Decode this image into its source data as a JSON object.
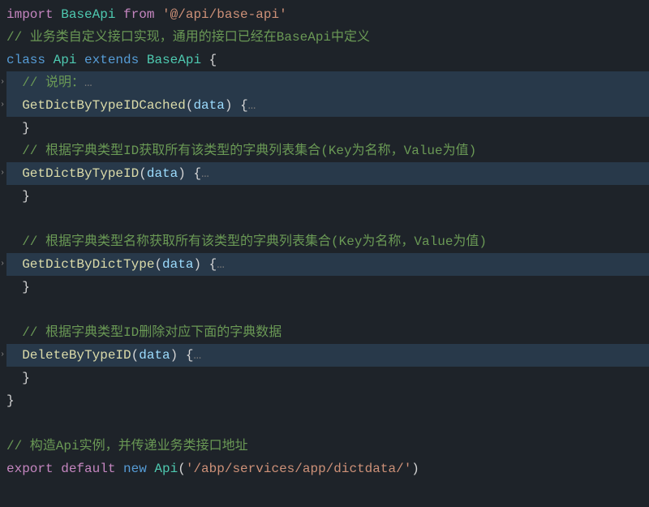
{
  "code": {
    "line1_import": "import",
    "line1_baseapi": " BaseApi",
    "line1_from": " from",
    "line1_path": " '@/api/base-api'",
    "line2_comment": "// 业务类自定义接口实现，通用的接口已经在BaseApi中定义",
    "line3_class": "class",
    "line3_api": " Api",
    "line3_extends": " extends",
    "line3_baseapi": " BaseApi",
    "line3_brace": " {",
    "line4_comment": "  // 说明：",
    "line4_dots": "…",
    "line5_method": "  GetDictByTypeIDCached",
    "line5_open": "(",
    "line5_param": "data",
    "line5_close": ") {",
    "line5_dots": "…",
    "line6_close": "  }",
    "line7_comment": "  // 根据字典类型ID获取所有该类型的字典列表集合(Key为名称，Value为值)",
    "line8_method": "  GetDictByTypeID",
    "line8_open": "(",
    "line8_param": "data",
    "line8_close": ") {",
    "line8_dots": "…",
    "line9_close": "  }",
    "line10_blank": "",
    "line11_comment": "  // 根据字典类型名称获取所有该类型的字典列表集合(Key为名称，Value为值)",
    "line12_method": "  GetDictByDictType",
    "line12_open": "(",
    "line12_param": "data",
    "line12_close": ") {",
    "line12_dots": "…",
    "line13_close": "  }",
    "line14_blank": "",
    "line15_comment": "  // 根据字典类型ID删除对应下面的字典数据",
    "line16_method": "  DeleteByTypeID",
    "line16_open": "(",
    "line16_param": "data",
    "line16_close": ") {",
    "line16_dots": "…",
    "line17_close": "  }",
    "line18_brace": "}",
    "line19_blank": "",
    "line20_comment": "// 构造Api实例，并传递业务类接口地址",
    "line21_export": "export",
    "line21_default": " default",
    "line21_new": " new",
    "line21_api": " Api",
    "line21_open": "(",
    "line21_path": "'/abp/services/app/dictdata/'",
    "line21_close": ")"
  }
}
